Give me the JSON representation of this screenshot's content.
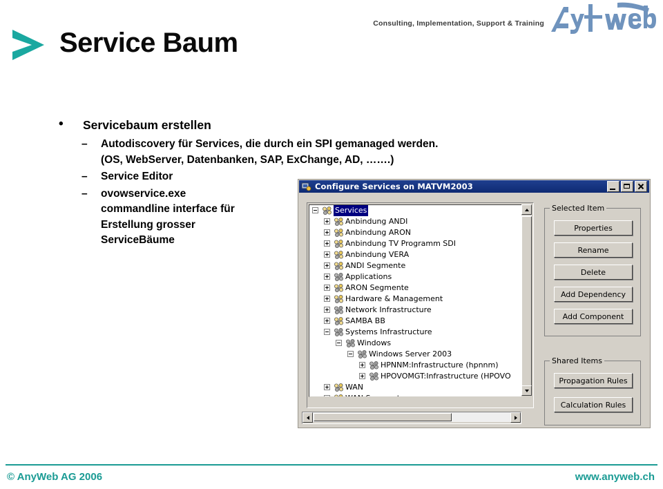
{
  "header": {
    "title": "Service Baum",
    "tagline": "Consulting, Implementation, Support & Training",
    "logo_text": "AnyWeb",
    "accent_color": "#1a9b94",
    "chevron_icon": "chevron-right-icon"
  },
  "content": {
    "bullets": [
      {
        "level": 1,
        "marker": "•",
        "text": "Servicebaum erstellen"
      },
      {
        "level": 2,
        "marker": "–",
        "text": "Autodiscovery für Services, die durch ein SPI gemanaged werden.",
        "continuation": "(OS, WebServer, Datenbanken, SAP, ExChange, AD, …….)"
      },
      {
        "level": 2,
        "marker": "–",
        "text": "Service Editor"
      },
      {
        "level": 2,
        "marker": "–",
        "text": "ovowservice.exe",
        "continuation": "commandline interface für Erstellung grosser ServiceBäume"
      }
    ]
  },
  "dialog": {
    "title": "Configure Services on MATVM2003",
    "title_icon": "services-app-icon",
    "titlebar_color": "#0e2a73",
    "window_buttons": [
      {
        "name": "minimize",
        "label": "_"
      },
      {
        "name": "maximize",
        "label": "□"
      },
      {
        "name": "close",
        "label": "✕"
      }
    ],
    "tree": {
      "selected_item": "Services",
      "items": [
        {
          "label": "Services",
          "depth": 0,
          "toggle": "minus",
          "icon": "service-group-icon",
          "selected": true
        },
        {
          "label": "Anbindung ANDI",
          "depth": 1,
          "toggle": "plus",
          "icon": "service-group-icon",
          "selected": false
        },
        {
          "label": "Anbindung ARON",
          "depth": 1,
          "toggle": "plus",
          "icon": "service-group-icon",
          "selected": false
        },
        {
          "label": "Anbindung TV Programm SDI",
          "depth": 1,
          "toggle": "plus",
          "icon": "service-group-icon",
          "selected": false
        },
        {
          "label": "Anbindung VERA",
          "depth": 1,
          "toggle": "plus",
          "icon": "service-group-icon",
          "selected": false
        },
        {
          "label": "ANDI Segmente",
          "depth": 1,
          "toggle": "plus",
          "icon": "service-group-icon",
          "selected": false
        },
        {
          "label": "Applications",
          "depth": 1,
          "toggle": "plus",
          "icon": "service-plain-icon",
          "selected": false
        },
        {
          "label": "ARON Segmente",
          "depth": 1,
          "toggle": "plus",
          "icon": "service-group-icon",
          "selected": false
        },
        {
          "label": "Hardware & Management",
          "depth": 1,
          "toggle": "plus",
          "icon": "service-group-icon",
          "selected": false
        },
        {
          "label": "Network Infrastructure",
          "depth": 1,
          "toggle": "plus",
          "icon": "service-plain-icon",
          "selected": false
        },
        {
          "label": "SAMBA BB",
          "depth": 1,
          "toggle": "plus",
          "icon": "service-group-icon",
          "selected": false
        },
        {
          "label": "Systems Infrastructure",
          "depth": 1,
          "toggle": "minus",
          "icon": "service-plain-icon",
          "selected": false
        },
        {
          "label": "Windows",
          "depth": 2,
          "toggle": "minus",
          "icon": "service-plain-icon",
          "selected": false
        },
        {
          "label": "Windows Server 2003",
          "depth": 3,
          "toggle": "minus",
          "icon": "service-plain-icon",
          "selected": false
        },
        {
          "label": "HPNNM:Infrastructure  (hpnnm)",
          "depth": 4,
          "toggle": "plus",
          "icon": "service-plain-icon",
          "selected": false
        },
        {
          "label": "HPOVOMGT:Infrastructure  (HPOVO",
          "depth": 4,
          "toggle": "plus",
          "icon": "service-plain-icon",
          "selected": false
        },
        {
          "label": "WAN",
          "depth": 1,
          "toggle": "plus",
          "icon": "service-group-icon",
          "selected": false
        },
        {
          "label": "WAN Segmente",
          "depth": 1,
          "toggle": "plus",
          "icon": "service-group-icon",
          "selected": false
        }
      ]
    },
    "selected_item_group": {
      "caption": "Selected Item",
      "buttons": [
        {
          "label": "Properties"
        },
        {
          "label": "Rename"
        },
        {
          "label": "Delete"
        },
        {
          "label": "Add Dependency"
        },
        {
          "label": "Add Component"
        }
      ]
    },
    "shared_items_group": {
      "caption": "Shared Items",
      "buttons": [
        {
          "label": "Propagation Rules"
        },
        {
          "label": "Calculation Rules"
        }
      ]
    }
  },
  "footer": {
    "copyright": "© AnyWeb AG 2006",
    "url": "www.anyweb.ch"
  }
}
